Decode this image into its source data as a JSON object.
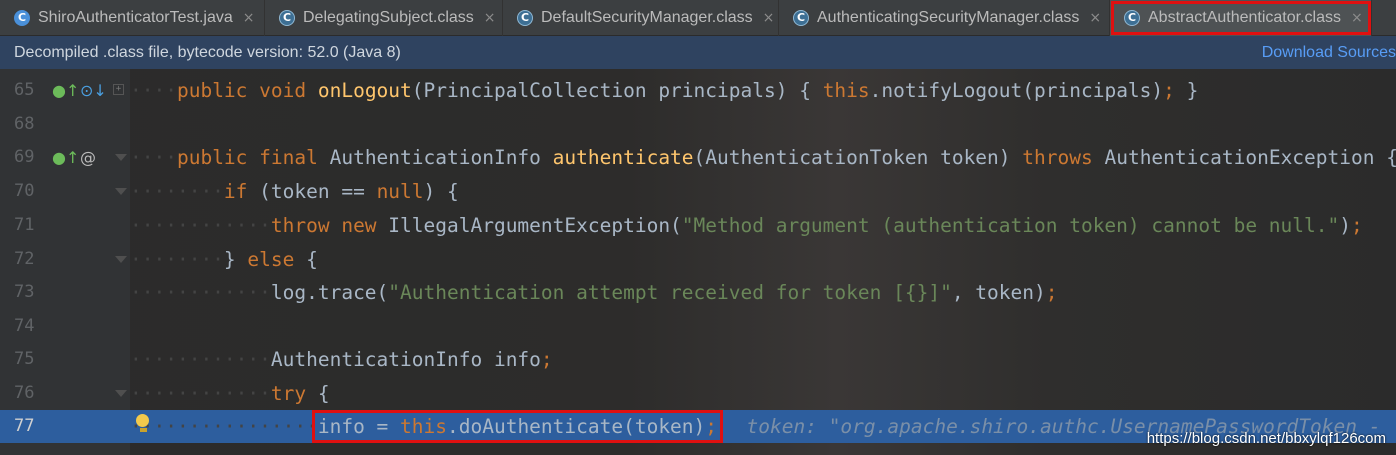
{
  "tabs": [
    {
      "label": "ShiroAuthenticatorTest.java",
      "icon": "java-class-icon",
      "active": false
    },
    {
      "label": "DelegatingSubject.class",
      "icon": "class-file-icon",
      "active": false
    },
    {
      "label": "DefaultSecurityManager.class",
      "icon": "class-file-icon",
      "active": false
    },
    {
      "label": "AuthenticatingSecurityManager.class",
      "icon": "class-file-icon",
      "active": false
    },
    {
      "label": "AbstractAuthenticator.class",
      "icon": "class-file-icon",
      "active": true
    }
  ],
  "banner": {
    "message": "Decompiled .class file, bytecode version: 52.0 (Java 8)",
    "download_link": "Download Sources"
  },
  "lines": [
    {
      "num": "65",
      "code": "public void onLogout(PrincipalCollection principals) { this.notifyLogout(principals); }",
      "marks": "override-implements"
    },
    {
      "num": "68",
      "code": ""
    },
    {
      "num": "69",
      "code": "public final AuthenticationInfo authenticate(AuthenticationToken token) throws AuthenticationException {",
      "marks": "override-annotation"
    },
    {
      "num": "70",
      "code": "if (token == null) {"
    },
    {
      "num": "71",
      "code": "throw new IllegalArgumentException(\"Method argument (authentication token) cannot be null.\");"
    },
    {
      "num": "72",
      "code": "} else {"
    },
    {
      "num": "73",
      "code": "log.trace(\"Authentication attempt received for token [{}]\", token);"
    },
    {
      "num": "74",
      "code": ""
    },
    {
      "num": "75",
      "code": "AuthenticationInfo info;"
    },
    {
      "num": "76",
      "code": "try {"
    },
    {
      "num": "77",
      "code": "info = this.doAuthenticate(token);",
      "current": true,
      "inline_hint": "token: \"org.apache.shiro.authc.UsernamePasswordToken -"
    }
  ],
  "watermark": "https://blog.csdn.net/bbxylqf126com",
  "colors": {
    "keyword": "#cc7832",
    "string": "#6a8759",
    "method": "#ffc66d",
    "current_line": "#2d5e9e",
    "highlight_box": "#e01010"
  }
}
